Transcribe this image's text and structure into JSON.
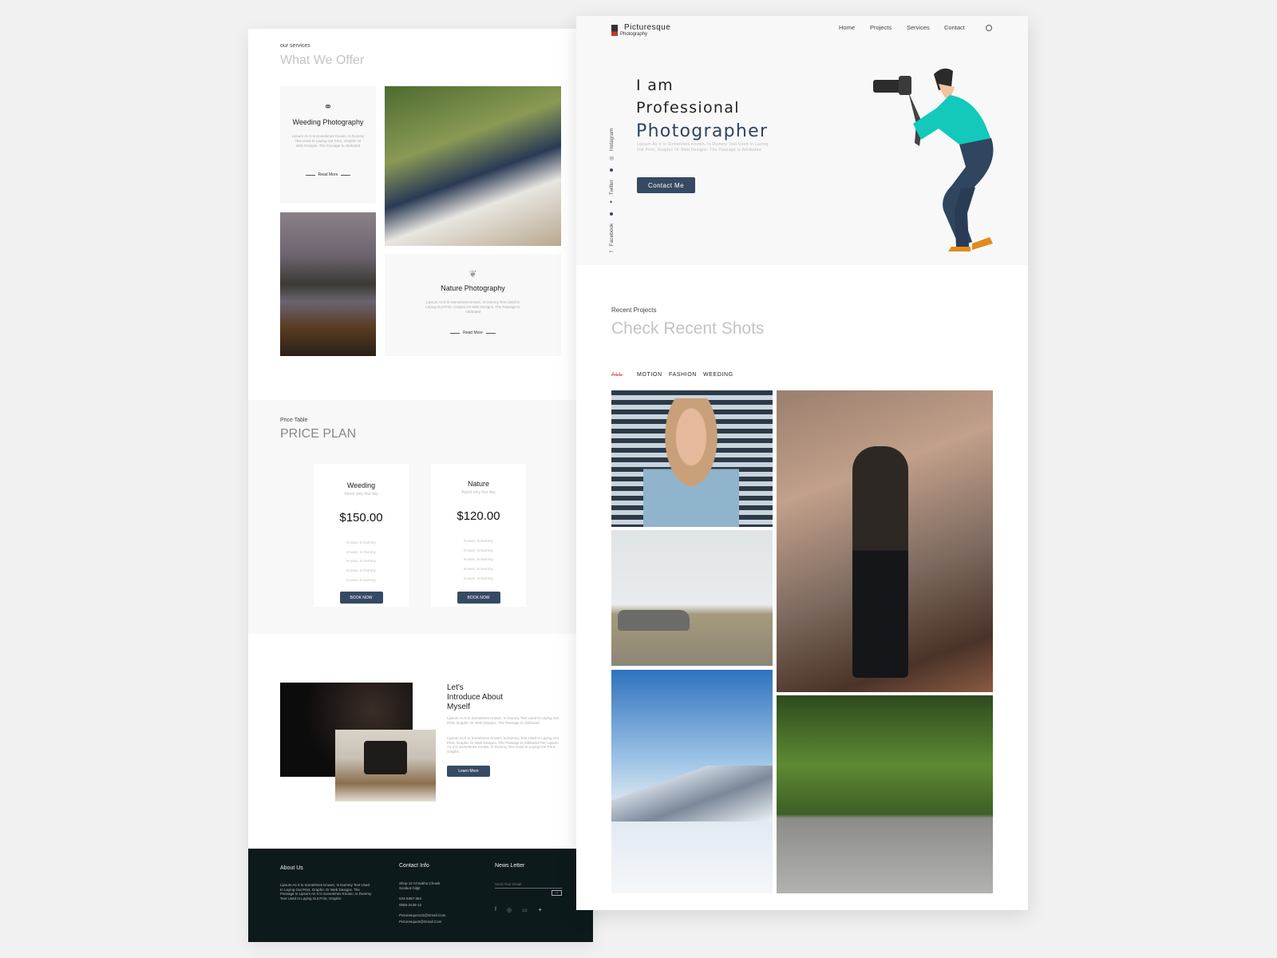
{
  "services": {
    "eyebrow": "our services",
    "title": "What We Offer",
    "cards": [
      {
        "title": "Weeding Photography",
        "icon": "rings-icon",
        "text": "Lipsum As It Is Sometimes Known, Is Dummy Text Used In Laying Out Print, Graphic Or Web Designs. The Passage Is Attributed",
        "link": "Read More"
      },
      {
        "title": "Nature Photography",
        "icon": "leaf-icon",
        "text": "Lipsum As It Is Sometimes Known, Is Dummy Text Used In Laying Out Print, Graphic Or Web Designs. The Passage Is Attributed",
        "link": "Read More"
      }
    ]
  },
  "pricing": {
    "eyebrow": "Price Table",
    "title": "PRICE PLAN",
    "plans": [
      {
        "name": "Weeding",
        "sub": "Atand only first day",
        "price": "$150.00",
        "features": [
          "Known, Is Dummy",
          "Known, Is Dummy",
          "Known, Is Dummy",
          "Known, Is Dummy",
          "Known, Is Dummy"
        ],
        "button": "BOOK NOW"
      },
      {
        "name": "Nature",
        "sub": "Atand only first day",
        "price": "$120.00",
        "features": [
          "Known, Is Dummy",
          "Known, Is Dummy",
          "Known, Is Dummy",
          "Known, Is Dummy",
          "Known, Is Dummy"
        ],
        "button": "BOOK NOW"
      }
    ]
  },
  "about": {
    "title_lines": [
      "Let's",
      "Introduce About",
      "Myself"
    ],
    "p1": "Lipsum As It Is Sometimes Known, Is Dummy Text Used In Laying Out Print, Graphic Or Web Designs. The Passage Is Attributed",
    "p2": "Lipsum As It Is Sometimes Known, Is Dummy Text Used In Laying Out Print, Graphic Or Web Designs. The Passage Is Attributed Per Lipsum As It Is Sometimes Known, Is Dummy Text Used In Laying Out Print, Graphic",
    "button": "Learn More"
  },
  "footer": {
    "about_title": "About Us",
    "about_text": "Lipsum As It Is Sometimes Known, Is Dummy Text Used In Laying Out Print, Graphic Or Web Designs. The Passage Is Lipsum As It Is Sometimes Known, Is Dummy Text Used In Laying Out Print, Graphic",
    "contact_title": "Contact Info",
    "address": "Shop 12 Al-Sabha Chowk Sonikot Gilgit",
    "phone1": "034-5367-354",
    "phone2": "0555-2435-12",
    "email1": "Picturesque122@Gmail.Com",
    "email2": "Picturesque2@Gmail.Com",
    "news_title": "News Letter",
    "email_placeholder": "Send Your Email",
    "socials": [
      "facebook-icon",
      "instagram-icon",
      "youtube-icon",
      "twitter-icon"
    ]
  },
  "header": {
    "brand": "Picturesque",
    "brand_sub": "Photography",
    "nav": [
      "Home",
      "Projects",
      "Services",
      "Contact"
    ]
  },
  "hero": {
    "line1": "I am",
    "line2": "Professional",
    "line3": "Photographer",
    "text": "Lipsum As It Is Sometimes Known, Is Dummy Text Used In Laying Out Print, Graphic Or Web Designs. The Passage Is Attributed",
    "button": "Contact Me",
    "socials": [
      "Instagram",
      "Twitter",
      "Facebook"
    ]
  },
  "projects": {
    "eyebrow": "Recent Projects",
    "title": "Check Recent Shots",
    "filters": [
      "ALL",
      "MOTION",
      "FASHION",
      "WEEDING"
    ],
    "active_filter": "ALL"
  },
  "colors": {
    "accent": "#364a63",
    "footer_bg": "#0d1a1c",
    "hero_bg": "#f8f8f8",
    "active_filter": "#e05a5a"
  }
}
